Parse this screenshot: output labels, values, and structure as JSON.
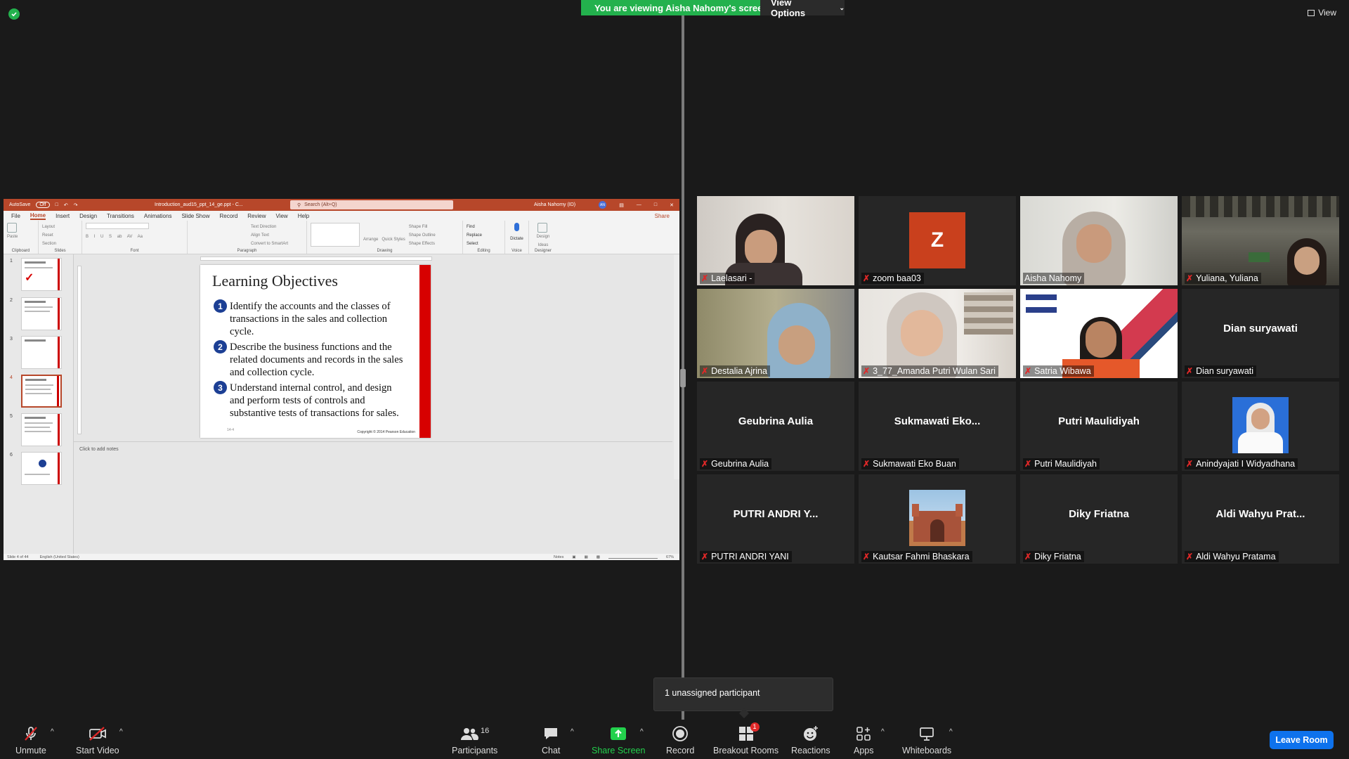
{
  "banner": {
    "viewing_text": "You are viewing Aisha Nahomy's screen",
    "view_options_label": "View Options",
    "view_label": "View"
  },
  "ppt": {
    "autosave_label": "AutoSave",
    "autosave_state": "Off",
    "file_name": "Introduction_aud15_ppt_14_ge.ppt - C...",
    "search_placeholder": "Search (Alt+Q)",
    "user": "Aisha Nahomy (ID)",
    "user_initials": "AN",
    "tabs": [
      "File",
      "Home",
      "Insert",
      "Design",
      "Transitions",
      "Animations",
      "Slide Show",
      "Record",
      "Review",
      "View",
      "Help"
    ],
    "share_label": "Share",
    "ribbon_groups": [
      {
        "name": "Clipboard",
        "items": [
          "Paste"
        ]
      },
      {
        "name": "Slides",
        "items": [
          "Layout",
          "Reset",
          "New Slide",
          "Section"
        ]
      },
      {
        "name": "Font",
        "items": [
          "B",
          "I",
          "U",
          "S",
          "ab",
          "AV",
          "Aa"
        ]
      },
      {
        "name": "Paragraph",
        "items": [
          "Text Direction",
          "Align Text",
          "Convert to SmartArt"
        ]
      },
      {
        "name": "Drawing",
        "items": [
          "Arrange",
          "Quick Styles",
          "Shape Fill",
          "Shape Outline",
          "Shape Effects"
        ]
      },
      {
        "name": "Editing",
        "items": [
          "Find",
          "Replace",
          "Select"
        ]
      },
      {
        "name": "Voice",
        "items": [
          "Dictate"
        ]
      },
      {
        "name": "Designer",
        "items": [
          "Design Ideas"
        ]
      }
    ],
    "thumb_numbers": [
      "1",
      "2",
      "3",
      "4",
      "5",
      "6"
    ],
    "slide": {
      "title": "Learning Objectives",
      "objectives": [
        {
          "n": "1",
          "text": "Identify the accounts and the classes of transactions in the sales and collection cycle."
        },
        {
          "n": "2",
          "text": "Describe the business functions and the related documents and records in the sales and collection cycle."
        },
        {
          "n": "3",
          "text": "Understand internal control, and design and perform tests of controls and substantive tests of transactions for sales."
        }
      ],
      "page": "14-4",
      "copyright": "Copyright © 2014 Pearson Education"
    },
    "notes_placeholder": "Click to add notes",
    "status": {
      "slide_count": "Slide 4 of 44",
      "language": "English (United States)",
      "notes": "Notes",
      "zoom": "67%"
    }
  },
  "participants": [
    {
      "name": "Laelasari -",
      "big": "",
      "cam": "cam1"
    },
    {
      "name": "zoom baa03",
      "big": "",
      "avatar": "Z"
    },
    {
      "name": "Aisha Nahomy",
      "big": "",
      "cam": "cam3",
      "speaking": true
    },
    {
      "name": "Yuliana, Yuliana",
      "big": "",
      "cam": "cam4"
    },
    {
      "name": "Destalia Ajrina",
      "big": "",
      "cam": "cam5"
    },
    {
      "name": "3_77_Amanda Putri Wulan Sari",
      "big": "",
      "cam": "cam6"
    },
    {
      "name": "Satria Wibawa",
      "big": "",
      "cam": "cam7"
    },
    {
      "name": "Dian suryawati",
      "big": "Dian suryawati"
    },
    {
      "name": "Geubrina Aulia",
      "big": "Geubrina Aulia"
    },
    {
      "name": "Sukmawati Eko Buan",
      "big": "Sukmawati  Eko..."
    },
    {
      "name": "Putri Maulidiyah",
      "big": "Putri Maulidiyah"
    },
    {
      "name": "Anindyajati I Widyadhana",
      "big": "",
      "pic": "portrait"
    },
    {
      "name": "PUTRI ANDRI YANI",
      "big": "PUTRI ANDRI Y..."
    },
    {
      "name": "Kautsar Fahmi Bhaskara",
      "big": "",
      "pic": "fort"
    },
    {
      "name": "Diky Friatna",
      "big": "Diky Friatna"
    },
    {
      "name": "Aldi Wahyu Pratama",
      "big": "Aldi  Wahyu  Prat..."
    }
  ],
  "popup_text": "1 unassigned participant",
  "toolbar": {
    "unmute": "Unmute",
    "start_video": "Start Video",
    "participants": "Participants",
    "participants_count": "16",
    "chat": "Chat",
    "share_screen": "Share Screen",
    "record": "Record",
    "breakout_rooms": "Breakout Rooms",
    "breakout_badge": "1",
    "reactions": "Reactions",
    "apps": "Apps",
    "whiteboards": "Whiteboards",
    "leave_room": "Leave Room"
  },
  "colors": {
    "zoom_green": "#23b14d",
    "speaker_outline": "#d7f05a",
    "ppt_accent": "#b7472a",
    "leave_blue": "#0e72ed",
    "mic_off_red": "#e02828"
  }
}
